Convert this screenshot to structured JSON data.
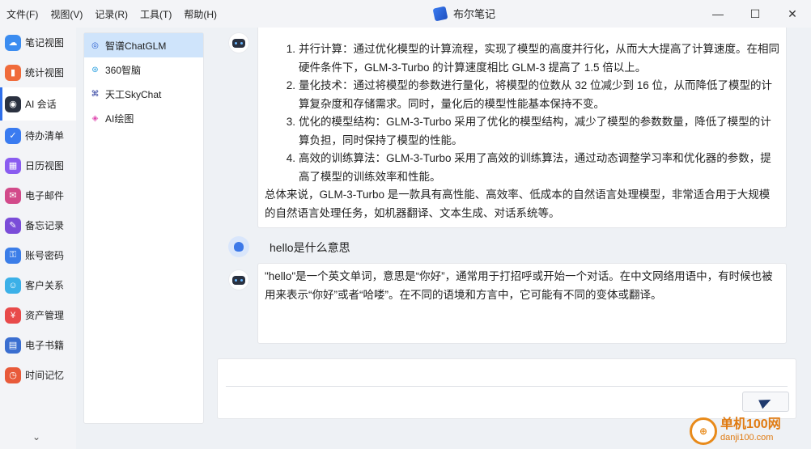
{
  "menu": [
    "文件(F)",
    "视图(V)",
    "记录(R)",
    "工具(T)",
    "帮助(H)"
  ],
  "app_title": "布尔笔记",
  "window_controls": {
    "minimize": "—",
    "maximize": "☐",
    "close": "✕"
  },
  "nav": {
    "items": [
      {
        "label": "笔记视图",
        "icon": "cloud-icon",
        "color": "#3b8cf0",
        "glyph": "☁"
      },
      {
        "label": "统计视图",
        "icon": "chart-icon",
        "color": "#f06b3b",
        "glyph": "▮"
      },
      {
        "label": "AI 会话",
        "icon": "robot-icon",
        "color": "#2a3140",
        "glyph": "◉",
        "active": true
      },
      {
        "label": "待办清单",
        "icon": "todo-icon",
        "color": "#3a7bf0",
        "glyph": "✓"
      },
      {
        "label": "日历视图",
        "icon": "calendar-icon",
        "color": "#8a5cf0",
        "glyph": "▦"
      },
      {
        "label": "电子邮件",
        "icon": "mail-icon",
        "color": "#d24a8a",
        "glyph": "✉"
      },
      {
        "label": "备忘记录",
        "icon": "memo-icon",
        "color": "#7a4cd8",
        "glyph": "✎"
      },
      {
        "label": "账号密码",
        "icon": "lock-icon",
        "color": "#3b7de8",
        "glyph": "⚿"
      },
      {
        "label": "客户关系",
        "icon": "people-icon",
        "color": "#3bb0e8",
        "glyph": "☺"
      },
      {
        "label": "资产管理",
        "icon": "asset-icon",
        "color": "#e84a4a",
        "glyph": "¥"
      },
      {
        "label": "电子书籍",
        "icon": "book-icon",
        "color": "#3a6ed0",
        "glyph": "▤"
      },
      {
        "label": "时间记忆",
        "icon": "clock-icon",
        "color": "#e85a3a",
        "glyph": "◷"
      }
    ],
    "more": "⌄"
  },
  "models": [
    {
      "label": "智谱ChatGLM",
      "icon": "chatglm-icon",
      "color": "#2a5fd0",
      "glyph": "◎",
      "active": true
    },
    {
      "label": "360智脑",
      "icon": "360-icon",
      "color": "#2aa0e0",
      "glyph": "⊛"
    },
    {
      "label": "天工SkyChat",
      "icon": "skychat-icon",
      "color": "#3040a0",
      "glyph": "⌘"
    },
    {
      "label": "AI绘图",
      "icon": "paint-icon",
      "color": "#e04ab0",
      "glyph": "◈"
    }
  ],
  "messages": {
    "answer1": {
      "items": [
        {
          "num": "1.",
          "text": "并行计算：通过优化模型的计算流程，实现了模型的高度并行化，从而大大提高了计算速度。在相同硬件条件下，GLM-3-Turbo 的计算速度相比 GLM-3 提高了 1.5 倍以上。"
        },
        {
          "num": "2.",
          "text": "量化技术：通过将模型的参数进行量化，将模型的位数从 32 位减少到 16 位，从而降低了模型的计算复杂度和存储需求。同时，量化后的模型性能基本保持不变。"
        },
        {
          "num": "3.",
          "text": "优化的模型结构：GLM-3-Turbo 采用了优化的模型结构，减少了模型的参数数量，降低了模型的计算负担，同时保持了模型的性能。"
        },
        {
          "num": "4.",
          "text": "高效的训练算法：GLM-3-Turbo 采用了高效的训练算法，通过动态调整学习率和优化器的参数，提高了模型的训练效率和性能。"
        }
      ],
      "summary": "总体来说，GLM-3-Turbo 是一款具有高性能、高效率、低成本的自然语言处理模型，非常适合用于大规模的自然语言处理任务，如机器翻译、文本生成、对话系统等。"
    },
    "question": "hello是什么意思",
    "answer2": "\"hello\"是一个英文单词，意思是“你好”，通常用于打招呼或开始一个对话。在中文网络用语中，有时候也被用来表示“你好”或者“哈喽”。在不同的语境和方言中，它可能有不同的变体或翻译。"
  },
  "input": {
    "placeholder": "",
    "value": ""
  },
  "watermark": {
    "line1": "单机100网",
    "line2": "danji100.com"
  }
}
